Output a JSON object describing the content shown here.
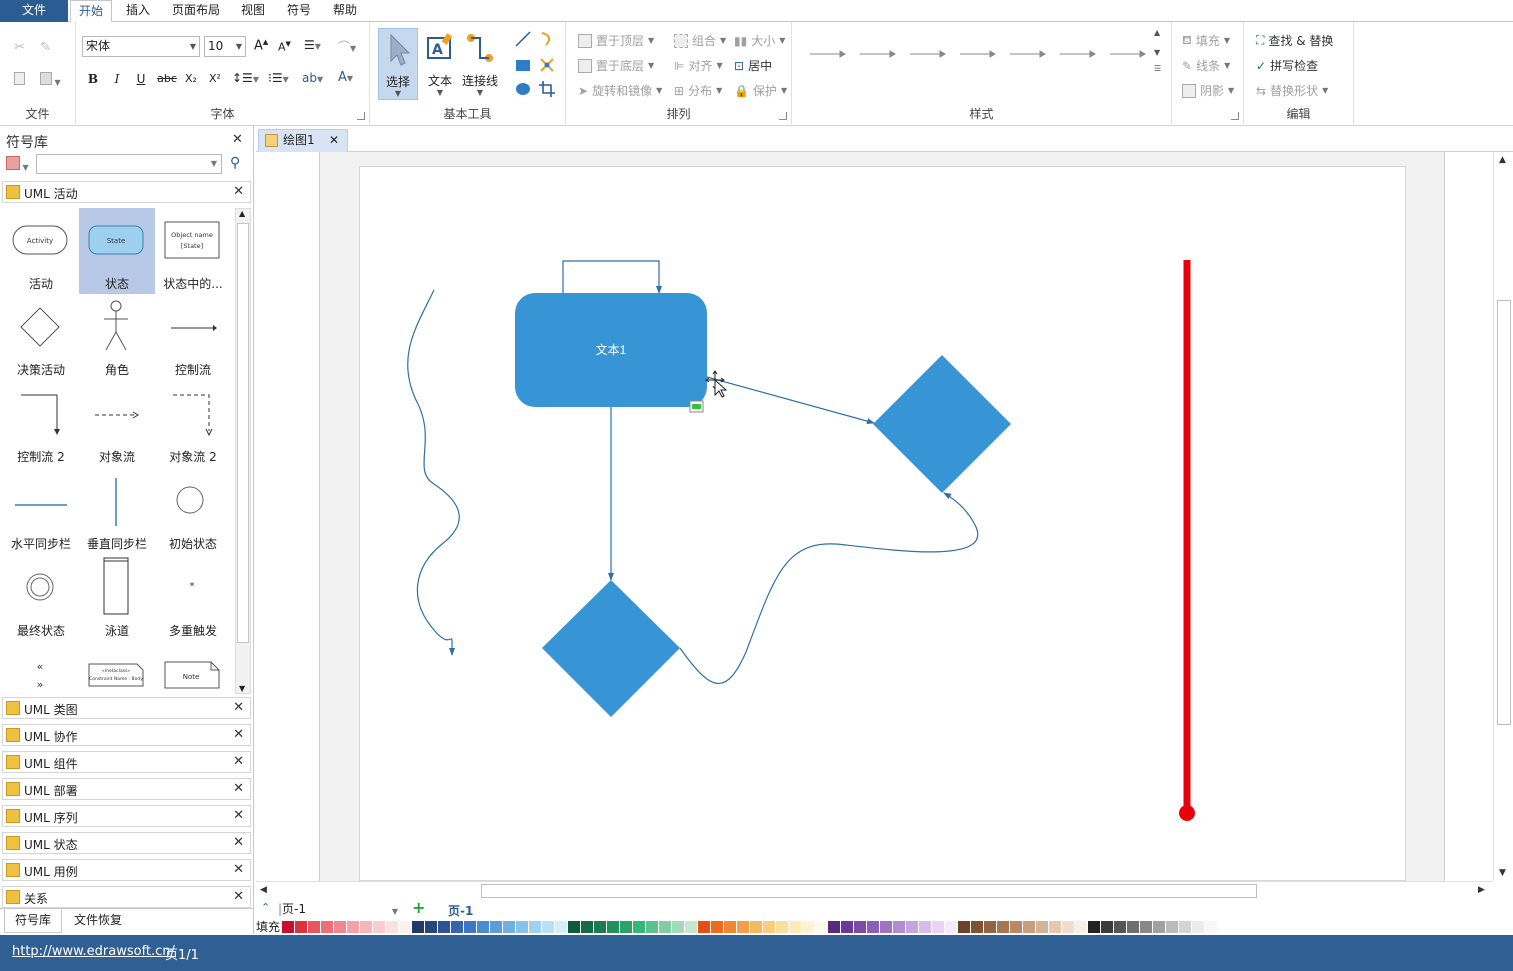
{
  "menubar": {
    "file": "文件",
    "tabs": [
      "开始",
      "插入",
      "页面布局",
      "视图",
      "符号",
      "帮助"
    ]
  },
  "ribbon": {
    "groups": {
      "file": "文件",
      "font": "字体",
      "basic_tools": "基本工具",
      "arrange": "排列",
      "style": "样式",
      "edit": "编辑"
    },
    "font_name": "宋体",
    "font_size": "10",
    "format_buttons": [
      "B",
      "I",
      "U",
      "abc",
      "X₂",
      "X²"
    ],
    "tools": {
      "select": "选择",
      "text": "文本",
      "connector": "连接线"
    },
    "arrange": {
      "bring_front": "置于顶层",
      "send_back": "置于底层",
      "rotate_mirror": "旋转和镜像",
      "group": "组合",
      "align": "对齐",
      "distribute": "分布",
      "size": "大小",
      "center": "居中",
      "protect": "保护"
    },
    "styles": {
      "fill": "填充",
      "line": "线条",
      "shadow": "阴影"
    },
    "edit": {
      "find_replace": "查找 & 替换",
      "spell_check": "拼写检查",
      "replace_shape": "替换形状"
    }
  },
  "library": {
    "title": "符号库",
    "current": "UML 活动",
    "symbols": [
      {
        "label": "活动",
        "preview": "Activity"
      },
      {
        "label": "状态",
        "preview": "State"
      },
      {
        "label": "状态中的...",
        "preview": "Object name [State]"
      },
      {
        "label": "决策活动"
      },
      {
        "label": "角色"
      },
      {
        "label": "控制流"
      },
      {
        "label": "控制流 2"
      },
      {
        "label": "对象流"
      },
      {
        "label": "对象流 2"
      },
      {
        "label": "水平同步栏"
      },
      {
        "label": "垂直同步栏"
      },
      {
        "label": "初始状态"
      },
      {
        "label": "最终状态"
      },
      {
        "label": "泳道"
      },
      {
        "label": "多重触发"
      },
      {
        "label": "",
        "preview": "« »"
      },
      {
        "label": "",
        "preview": "Constraint Name : Body"
      },
      {
        "label": "",
        "preview": "Note"
      }
    ],
    "other_libraries": [
      "UML 类图",
      "UML 协作",
      "UML 组件",
      "UML 部署",
      "UML 序列",
      "UML 状态",
      "UML 用例",
      "关系"
    ],
    "bottom_tabs": [
      "符号库",
      "文件恢复"
    ]
  },
  "document": {
    "tab_name": "绘图1",
    "shape_text": "文本1",
    "page_combo": "页-1",
    "page_tab": "页-1",
    "fill_label": "填充"
  },
  "palette": [
    "#c8102e",
    "#e0323c",
    "#e8545f",
    "#ee6f7a",
    "#f08892",
    "#f4a1a9",
    "#f6b7bc",
    "#f8ccd0",
    "#fbe0e2",
    "#fdf0f1",
    "#1f3a68",
    "#27467f",
    "#2d5496",
    "#3465ad",
    "#3c77c4",
    "#4a8bd1",
    "#5b9ddb",
    "#6fb0e3",
    "#86c2ea",
    "#9fd2f0",
    "#b9e0f5",
    "#d4edf9",
    "#0e5a3c",
    "#136b47",
    "#1a7d52",
    "#22905e",
    "#2aa36b",
    "#36b67a",
    "#5bc28e",
    "#7fcea3",
    "#a3dab9",
    "#c7e6cf",
    "#e84e0f",
    "#ed6a1f",
    "#f08532",
    "#f4a04a",
    "#f7b864",
    "#f9cd80",
    "#fbdd9c",
    "#fde9b9",
    "#fef2d4",
    "#fff9ea",
    "#5a2a82",
    "#6b3a94",
    "#7c4ba6",
    "#8e5db6",
    "#a073c3",
    "#b38bd0",
    "#c5a3dc",
    "#d7bce7",
    "#e8d5f1",
    "#f4ebf8",
    "#6b4226",
    "#7e5234",
    "#926343",
    "#a67553",
    "#b98866",
    "#c99d7d",
    "#d7b396",
    "#e4c9b0",
    "#efdecb",
    "#f7eee4",
    "#222222",
    "#3b3b3b",
    "#555555",
    "#6e6e6e",
    "#888888",
    "#a1a1a1",
    "#bbbbbb",
    "#d4d4d4",
    "#ebebeb",
    "#f7f7f7"
  ],
  "statusbar": {
    "url": "http://www.edrawsoft.cn/",
    "page": "页1/1"
  },
  "colors": {
    "accent": "#2b5d92",
    "shape_fill": "#3795d6",
    "red_line": "#e8000b"
  }
}
